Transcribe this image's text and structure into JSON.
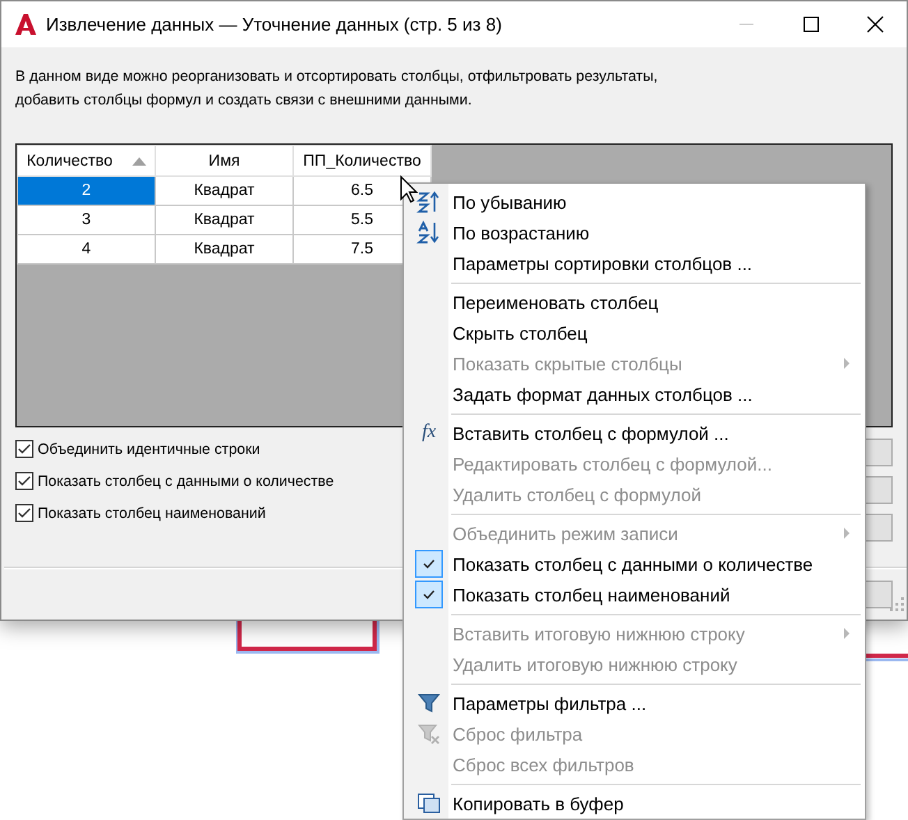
{
  "window": {
    "title": "Извлечение данных — Уточнение данных (стр. 5 из 8)"
  },
  "description": "В данном виде можно реорганизовать и отсортировать столбцы, отфильтровать результаты,\nдобавить столбцы формул и создать связи с внешними данными.",
  "table": {
    "columns": [
      {
        "label": "Количество",
        "sorted": true
      },
      {
        "label": "Имя",
        "sorted": false
      },
      {
        "label": "ПП_Количество",
        "sorted": false
      }
    ],
    "rows": [
      {
        "cells": [
          "2",
          "Квадрат",
          "6.5"
        ],
        "selected": true
      },
      {
        "cells": [
          "3",
          "Квадрат",
          "5.5"
        ],
        "selected": false
      },
      {
        "cells": [
          "4",
          "Квадрат",
          "7.5"
        ],
        "selected": false
      }
    ]
  },
  "options": [
    {
      "label": "Объединить идентичные строки",
      "checked": true
    },
    {
      "label": "Показать столбец с данными о количестве",
      "checked": true
    },
    {
      "label": "Показать столбец наименований",
      "checked": true
    }
  ],
  "context_menu": [
    {
      "kind": "item",
      "label": "По убыванию",
      "disabled": false,
      "checked": false,
      "submenu": false
    },
    {
      "kind": "item",
      "label": "По возрастанию",
      "disabled": false,
      "checked": false,
      "submenu": false
    },
    {
      "kind": "item",
      "label": "Параметры сортировки столбцов ...",
      "disabled": false,
      "checked": false,
      "submenu": false
    },
    {
      "kind": "separator"
    },
    {
      "kind": "item",
      "label": "Переименовать столбец",
      "disabled": false,
      "checked": false,
      "submenu": false
    },
    {
      "kind": "item",
      "label": "Скрыть столбец",
      "disabled": false,
      "checked": false,
      "submenu": false
    },
    {
      "kind": "item",
      "label": "Показать скрытые столбцы",
      "disabled": true,
      "checked": false,
      "submenu": true
    },
    {
      "kind": "item",
      "label": "Задать формат данных столбцов ...",
      "disabled": false,
      "checked": false,
      "submenu": false
    },
    {
      "kind": "separator"
    },
    {
      "kind": "item",
      "label": "Вставить столбец с формулой ...",
      "icon_text": "fx",
      "disabled": false,
      "checked": false,
      "submenu": false
    },
    {
      "kind": "item",
      "label": "Редактировать столбец с формулой...",
      "disabled": true,
      "checked": false,
      "submenu": false
    },
    {
      "kind": "item",
      "label": "Удалить столбец с формулой",
      "disabled": true,
      "checked": false,
      "submenu": false
    },
    {
      "kind": "separator"
    },
    {
      "kind": "item",
      "label": "Объединить режим записи",
      "disabled": true,
      "checked": false,
      "submenu": true
    },
    {
      "kind": "item",
      "label": "Показать столбец с данными о количестве",
      "disabled": false,
      "checked": true,
      "submenu": false
    },
    {
      "kind": "item",
      "label": "Показать столбец наименований",
      "disabled": false,
      "checked": true,
      "submenu": false
    },
    {
      "kind": "separator"
    },
    {
      "kind": "item",
      "label": "Вставить итоговую нижнюю строку",
      "disabled": true,
      "checked": false,
      "submenu": true
    },
    {
      "kind": "item",
      "label": "Удалить итоговую нижнюю строку",
      "disabled": true,
      "checked": false,
      "submenu": false
    },
    {
      "kind": "separator"
    },
    {
      "kind": "item",
      "label": "Параметры фильтра ...",
      "disabled": false,
      "checked": false,
      "submenu": false
    },
    {
      "kind": "item",
      "label": "Сброс фильтра",
      "disabled": true,
      "checked": false,
      "submenu": false
    },
    {
      "kind": "item",
      "label": "Сброс всех фильтров",
      "disabled": true,
      "checked": false,
      "submenu": false
    },
    {
      "kind": "separator"
    },
    {
      "kind": "item",
      "label": "Копировать в буфер",
      "disabled": false,
      "checked": false,
      "submenu": false
    }
  ]
}
